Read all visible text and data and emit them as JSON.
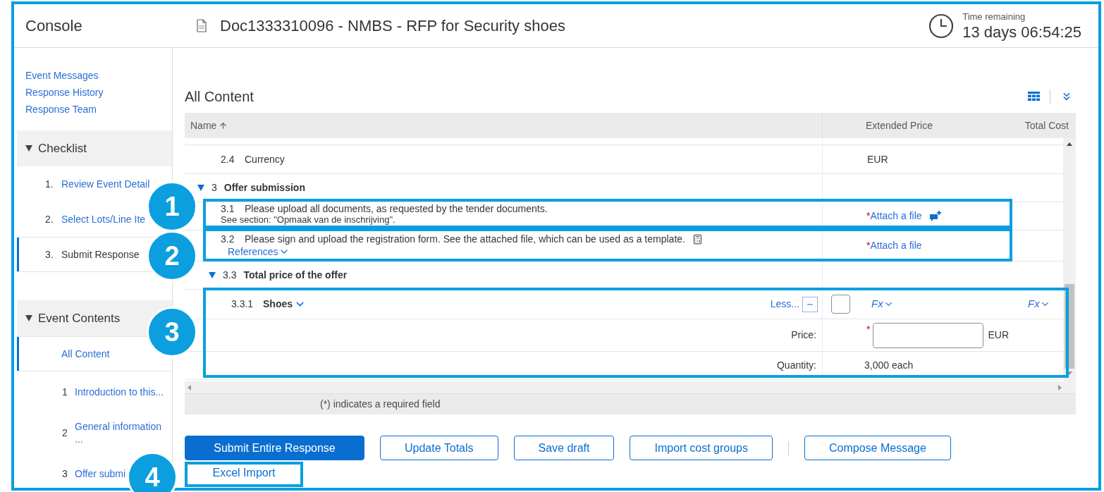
{
  "header": {
    "console_title": "Console",
    "document_title": "Doc1333310096 - NMBS - RFP for Security shoes",
    "time_label": "Time remaining",
    "time_value": "13 days 06:54:25"
  },
  "sidebar": {
    "links": [
      "Event Messages",
      "Response History",
      "Response Team"
    ],
    "sections": [
      {
        "kind": "checklist",
        "title": "Checklist",
        "expanded": true,
        "items": [
          {
            "number": "1.",
            "label": "Review Event Detail",
            "selected": false
          },
          {
            "number": "2.",
            "label": "Select Lots/Line Ite",
            "selected": false
          },
          {
            "number": "3.",
            "label": "Submit Response",
            "selected": true
          }
        ]
      },
      {
        "kind": "contents",
        "title": "Event Contents",
        "expanded": true,
        "items": [
          {
            "label": "All Content",
            "selected": true
          },
          {
            "number": "1",
            "label": "Introduction to this...",
            "selected": false
          },
          {
            "number": "2",
            "label": "General information ...",
            "selected": false
          },
          {
            "number": "3",
            "label": "Offer submi",
            "selected": false
          }
        ]
      }
    ]
  },
  "main": {
    "title": "All Content",
    "table": {
      "columns": [
        "Name",
        "Extended Price",
        "Total Cost"
      ],
      "rows": [
        {
          "kind": "item",
          "number": "2.4",
          "name": "Currency",
          "extended_price": "EUR"
        },
        {
          "kind": "section",
          "number": "3",
          "name": "Offer submission",
          "expanded": true
        },
        {
          "kind": "question",
          "number": "3.1",
          "text": "Please upload all documents, as requested by the tender documents.",
          "note": "See section: \"Opmaak van de inschrijving\".",
          "required_mark": "*",
          "action": "Attach a file",
          "comment_button": true
        },
        {
          "kind": "question",
          "number": "3.2",
          "text": "Please sign and upload the registration form. See the attached file, which can be used as a template.",
          "link": "References",
          "required_mark": "*",
          "action": "Attach a file",
          "attachment": true
        },
        {
          "kind": "subsection",
          "number": "3.3",
          "name": "Total price of the offer",
          "expanded": true
        },
        {
          "kind": "line_item",
          "number": "3.3.1",
          "name": "Shoes",
          "less_label": "Less...",
          "checked": false,
          "extended_price_formula": "Fx",
          "total_cost_formula": "Fx"
        },
        {
          "kind": "price_field",
          "label": "Price:",
          "required_mark": "*",
          "currency": "EUR"
        },
        {
          "kind": "value",
          "label": "Quantity:",
          "value": "3,000 each"
        }
      ]
    },
    "footnote": "(*) indicates a required field"
  },
  "buttons": [
    {
      "label": "Submit Entire Response",
      "primary": true
    },
    {
      "label": "Update Totals",
      "primary": false
    },
    {
      "label": "Save draft",
      "primary": false
    },
    {
      "label": "Import cost groups",
      "primary": false,
      "divider_after": true
    },
    {
      "label": "Compose Message",
      "primary": false
    }
  ],
  "second_row_buttons": [
    {
      "label": "Excel Import",
      "primary": false
    }
  ],
  "callouts": [
    {
      "number": "1"
    },
    {
      "number": "2"
    },
    {
      "number": "3"
    },
    {
      "number": "4"
    }
  ]
}
